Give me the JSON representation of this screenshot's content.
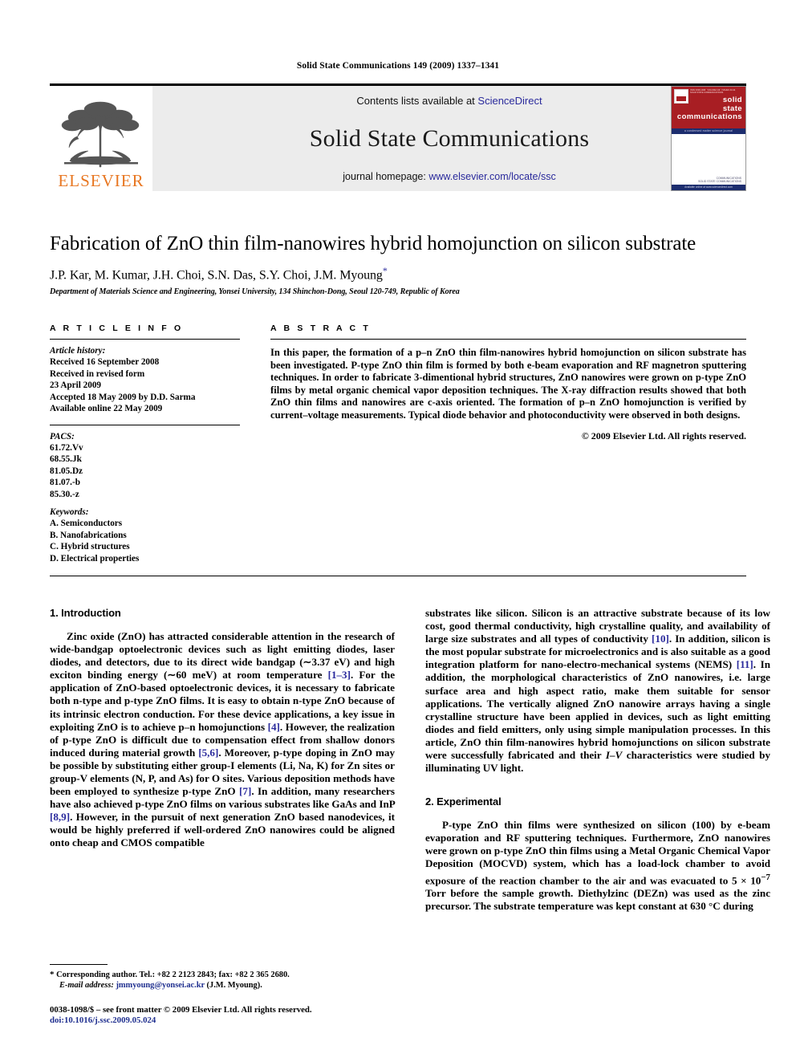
{
  "running_head": "Solid State Communications 149 (2009) 1337–1341",
  "header": {
    "contents_prefix": "Contents lists available at ",
    "sciencedirect": "ScienceDirect",
    "journal_title": "Solid State Communications",
    "homepage_label": "journal homepage: ",
    "homepage_url": "www.elsevier.com/locate/ssc",
    "publisher_logo_text": "ELSEVIER",
    "cover": {
      "line1": "solid",
      "line2": "state",
      "line3": "communications",
      "tagline": "a condensed matter science journal",
      "footer_line1": "COMMUNICATIONS",
      "footer_line2": "SOLID STATE COMMUNICATIONS",
      "bottom_bar": "Available online at www.sciencedirect.com"
    }
  },
  "article": {
    "title": "Fabrication of ZnO thin film-nanowires hybrid homojunction on silicon substrate",
    "authors": "J.P. Kar, M. Kumar, J.H. Choi, S.N. Das, S.Y. Choi, J.M. Myoung",
    "author_star": "*",
    "affiliation": "Department of Materials Science and Engineering, Yonsei University, 134 Shinchon-Dong, Seoul 120-749, Republic of Korea"
  },
  "info": {
    "section_label": "A R T I C L E   I N F O",
    "history_heading": "Article history:",
    "history": [
      "Received 16 September 2008",
      "Received in revised form",
      "23 April 2009",
      "Accepted 18 May 2009 by D.D. Sarma",
      "Available online 22 May 2009"
    ],
    "pacs_heading": "PACS:",
    "pacs": [
      "61.72.Vv",
      "68.55.Jk",
      "81.05.Dz",
      "81.07.-b",
      "85.30.-z"
    ],
    "keywords_heading": "Keywords:",
    "keywords": [
      "A. Semiconductors",
      "B. Nanofabrications",
      "C. Hybrid structures",
      "D. Electrical properties"
    ]
  },
  "abstract": {
    "section_label": "A B S T R A C T",
    "text": "In this paper, the formation of a p–n ZnO thin film-nanowires hybrid homojunction on silicon substrate has been investigated. P-type ZnO thin film is formed by both e-beam evaporation and RF magnetron sputtering techniques. In order to fabricate 3-dimentional hybrid structures, ZnO nanowires were grown on p-type ZnO films by metal organic chemical vapor deposition techniques. The X-ray diffraction results showed that both ZnO thin films and nanowires are c-axis oriented. The formation of p–n ZnO homojunction is verified by current–voltage measurements. Typical diode behavior and photoconductivity were observed in both designs.",
    "copyright": "© 2009 Elsevier Ltd. All rights reserved."
  },
  "body": {
    "intro_heading": "1. Introduction",
    "intro_p1_a": "Zinc oxide (ZnO) has attracted considerable attention in the research of wide-bandgap optoelectronic devices such as light emitting diodes, laser diodes, and detectors, due to its direct wide bandgap (∼3.37 eV) and high exciton binding energy (∼60 meV) at room temperature ",
    "intro_ref_1_3": "[1–3]",
    "intro_p1_b": ". For the application of ZnO-based optoelectronic devices, it is necessary to fabricate both n-type and p-type ZnO films. It is easy to obtain n-type ZnO because of its intrinsic electron conduction. For these device applications, a key issue in exploiting ZnO is to achieve p–n homojunctions ",
    "intro_ref_4": "[4]",
    "intro_p1_c": ". However, the realization of p-type ZnO is difficult due to compensation effect from shallow donors induced during material growth ",
    "intro_ref_5_6": "[5,6]",
    "intro_p1_d": ". Moreover, p-type doping in ZnO may be possible by substituting either group-I elements (Li, Na, K) for Zn sites or group-V elements (N, P, and As) for O sites. Various deposition methods have been employed to synthesize p-type ZnO ",
    "intro_ref_7": "[7]",
    "intro_p1_e": ". In addition, many researchers have also achieved p-type ZnO films on various substrates like GaAs and InP ",
    "intro_ref_8_9": "[8,9]",
    "intro_p1_f": ". However, in the pursuit of next generation ZnO based nanodevices, it would be highly preferred if well-ordered ZnO nanowires could be aligned onto cheap and CMOS compatible",
    "right_p1_a": "substrates like silicon. Silicon is an attractive substrate because of its low cost, good thermal conductivity, high crystalline quality, and availability of large size substrates and all types of conductivity ",
    "right_ref_10": "[10]",
    "right_p1_b": ". In addition, silicon is the most popular substrate for microelectronics and is also suitable as a good integration platform for nano-electro-mechanical systems (NEMS) ",
    "right_ref_11": "[11]",
    "right_p1_c": ". In addition, the morphological characteristics of ZnO nanowires, i.e. large surface area and high aspect ratio, make them suitable for sensor applications. The vertically aligned ZnO nanowire arrays having a single crystalline structure have been applied in devices, such as light emitting diodes and field emitters, only using simple manipulation processes. In this article, ZnO thin film-nanowires hybrid homojunctions on silicon substrate were successfully fabricated and their ",
    "right_p1_iv": "I–V",
    "right_p1_d": " characteristics were studied by illuminating UV light.",
    "experimental_heading": "2. Experimental",
    "exp_p1_a": "P-type ZnO thin films were synthesized on silicon (100) by e-beam evaporation and RF sputtering techniques. Furthermore, ZnO nanowires were grown on p-type ZnO thin films using a Metal Organic Chemical Vapor Deposition (MOCVD) system, which has a load-lock chamber to avoid exposure of the reaction chamber to the air and was evacuated to 5 × 10",
    "exp_sup": "−7",
    "exp_p1_b": " Torr before the sample growth. Diethylzinc (DEZn) was used as the zinc precursor. The substrate temperature was kept constant at 630 °C during"
  },
  "footnotes": {
    "star": "*",
    "corresponding": " Corresponding author. Tel.: +82 2 2123 2843; fax: +82 2 365 2680.",
    "email_label": "E-mail address:",
    "email": " jmmyoung@yonsei.ac.kr",
    "email_suffix": " (J.M. Myoung).",
    "issn_line": "0038-1098/$ – see front matter © 2009 Elsevier Ltd. All rights reserved.",
    "doi_line": "doi:10.1016/j.ssc.2009.05.024"
  }
}
